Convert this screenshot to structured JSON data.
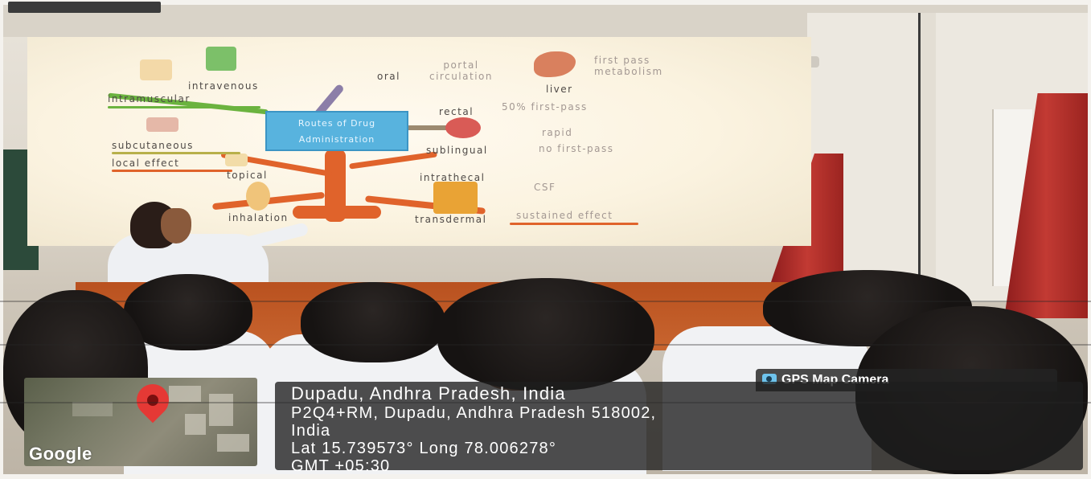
{
  "slide": {
    "title_line1": "Routes of Drug",
    "title_line2": "Administration",
    "labels": {
      "intravenous": "intravenous",
      "intramuscular": "intramuscular",
      "subcutaneous": "subcutaneous",
      "local_effect": "local effect",
      "topical": "topical",
      "inhalation": "inhalation",
      "oral": "oral",
      "portal_circulation": "portal\ncirculation",
      "first_pass_metabolism": "first pass\nmetabolism",
      "liver": "liver",
      "rectal": "rectal",
      "fifty_first_pass": "50% first-pass",
      "rapid": "rapid",
      "sublingual": "sublingual",
      "no_first_pass": "no first-pass",
      "intrathecal": "intrathecal",
      "csf": "CSF",
      "transdermal": "transdermal",
      "sustained_effect": "sustained effect"
    }
  },
  "gps": {
    "badge": "GPS Map Camera",
    "map_brand": "Google",
    "place": "Dupadu, Andhra Pradesh, India",
    "address_line1": "P2Q4+RM, Dupadu, Andhra Pradesh 518002,",
    "address_line2": "India",
    "coordinates": "Lat 15.739573° Long 78.006278°",
    "timezone": "GMT +05:30"
  },
  "colors": {
    "tree": "#e0632b",
    "center_box": "#58b3de",
    "pin": "#e53935",
    "overlay": "#1e1e1e",
    "curtain": "#b8302b"
  }
}
